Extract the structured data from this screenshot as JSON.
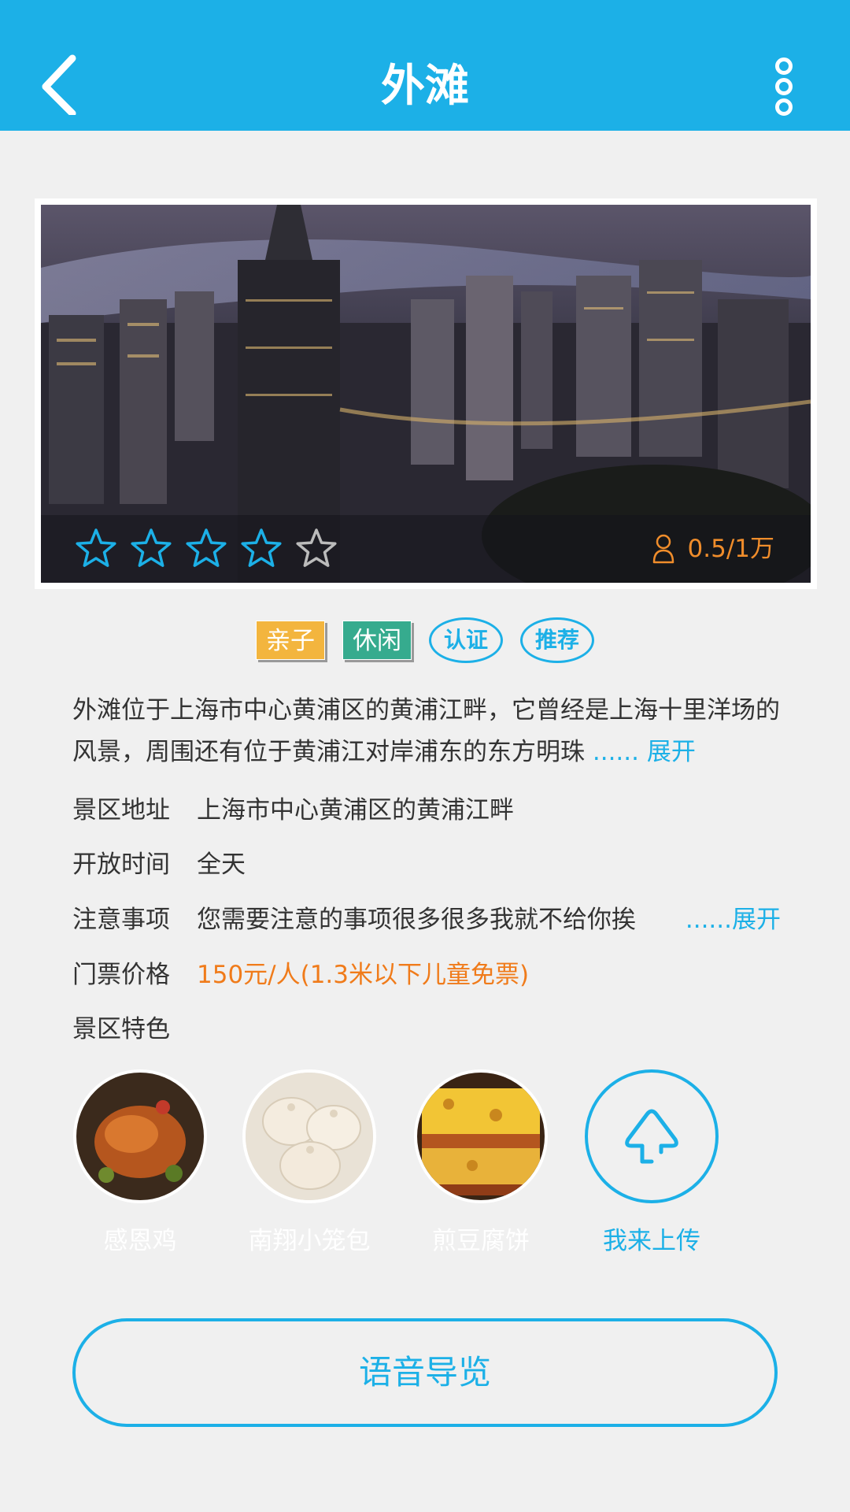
{
  "header": {
    "title": "外滩",
    "back_icon": "chevron-left-icon",
    "more_icon": "vertical-dots-icon",
    "color": "#1cb0e7"
  },
  "hero": {
    "rating": 4,
    "rating_max": 5,
    "visits": "0.5/1万",
    "visits_color": "#f08d2b"
  },
  "tags": {
    "family": "亲子",
    "leisure": "休闲",
    "certified": "认证",
    "recommended": "推荐"
  },
  "description": {
    "text": "外滩位于上海市中心黄浦区的黄浦江畔，它曾经是上海十里洋场的风景，周围还有位于黄浦江对岸浦东的东方明珠",
    "expand_label": "...... 展开"
  },
  "info": {
    "address_label": "景区地址",
    "address_value": "上海市中心黄浦区的黄浦江畔",
    "hours_label": "开放时间",
    "hours_value": "全天",
    "notice_label": "注意事项",
    "notice_value": "您需要注意的事项很多很多我就不给你挨",
    "notice_expand": "......展开",
    "price_label": "门票价格",
    "price_value": "150元/人(1.3米以下儿童免票)",
    "features_label": "景区特色"
  },
  "features": [
    {
      "name": "感恩鸡"
    },
    {
      "name": "南翔小笼包"
    },
    {
      "name": "煎豆腐饼"
    },
    {
      "name": "我来上传"
    }
  ],
  "voice_button": "语音导览"
}
